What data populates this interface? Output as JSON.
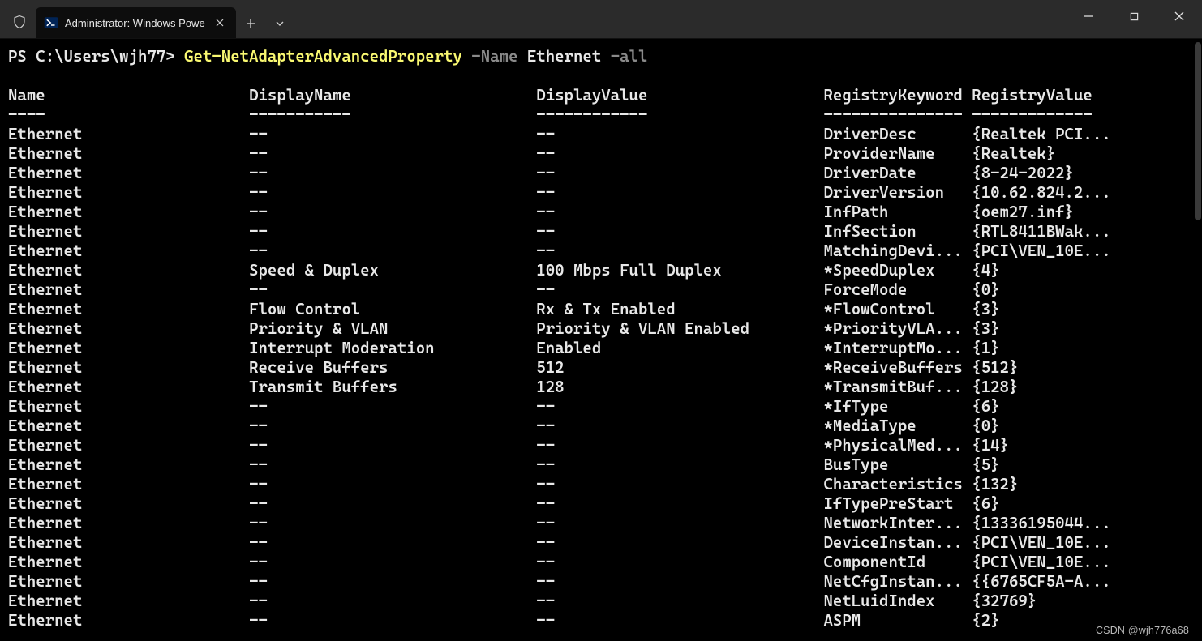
{
  "window": {
    "tab_title": "Administrator: Windows Powe",
    "watermark": "CSDN @wjh776a68"
  },
  "prompt": {
    "prefix": "PS C:\\Users\\wjh77> ",
    "command": "Get-NetAdapterAdvancedProperty",
    "param1": " -Name ",
    "arg1": "Ethernet",
    "param2": " -all"
  },
  "columns": {
    "name": "Name",
    "display_name": "DisplayName",
    "display_value": "DisplayValue",
    "registry_keyword": "RegistryKeyword",
    "registry_value": "RegistryValue"
  },
  "rows": [
    {
      "n": "Ethernet",
      "dn": "--",
      "dv": "--",
      "rk": "DriverDesc",
      "rv": "{Realtek PCI..."
    },
    {
      "n": "Ethernet",
      "dn": "--",
      "dv": "--",
      "rk": "ProviderName",
      "rv": "{Realtek}"
    },
    {
      "n": "Ethernet",
      "dn": "--",
      "dv": "--",
      "rk": "DriverDate",
      "rv": "{8-24-2022}"
    },
    {
      "n": "Ethernet",
      "dn": "--",
      "dv": "--",
      "rk": "DriverVersion",
      "rv": "{10.62.824.2..."
    },
    {
      "n": "Ethernet",
      "dn": "--",
      "dv": "--",
      "rk": "InfPath",
      "rv": "{oem27.inf}"
    },
    {
      "n": "Ethernet",
      "dn": "--",
      "dv": "--",
      "rk": "InfSection",
      "rv": "{RTL8411BWak..."
    },
    {
      "n": "Ethernet",
      "dn": "--",
      "dv": "--",
      "rk": "MatchingDevi...",
      "rv": "{PCI\\VEN_10E..."
    },
    {
      "n": "Ethernet",
      "dn": "Speed & Duplex",
      "dv": "100 Mbps Full Duplex",
      "rk": "*SpeedDuplex",
      "rv": "{4}"
    },
    {
      "n": "Ethernet",
      "dn": "--",
      "dv": "--",
      "rk": "ForceMode",
      "rv": "{0}"
    },
    {
      "n": "Ethernet",
      "dn": "Flow Control",
      "dv": "Rx & Tx Enabled",
      "rk": "*FlowControl",
      "rv": "{3}"
    },
    {
      "n": "Ethernet",
      "dn": "Priority & VLAN",
      "dv": "Priority & VLAN Enabled",
      "rk": "*PriorityVLA...",
      "rv": "{3}"
    },
    {
      "n": "Ethernet",
      "dn": "Interrupt Moderation",
      "dv": "Enabled",
      "rk": "*InterruptMo...",
      "rv": "{1}"
    },
    {
      "n": "Ethernet",
      "dn": "Receive Buffers",
      "dv": "512",
      "rk": "*ReceiveBuffers",
      "rv": "{512}"
    },
    {
      "n": "Ethernet",
      "dn": "Transmit Buffers",
      "dv": "128",
      "rk": "*TransmitBuf...",
      "rv": "{128}"
    },
    {
      "n": "Ethernet",
      "dn": "--",
      "dv": "--",
      "rk": "*IfType",
      "rv": "{6}"
    },
    {
      "n": "Ethernet",
      "dn": "--",
      "dv": "--",
      "rk": "*MediaType",
      "rv": "{0}"
    },
    {
      "n": "Ethernet",
      "dn": "--",
      "dv": "--",
      "rk": "*PhysicalMed...",
      "rv": "{14}"
    },
    {
      "n": "Ethernet",
      "dn": "--",
      "dv": "--",
      "rk": "BusType",
      "rv": "{5}"
    },
    {
      "n": "Ethernet",
      "dn": "--",
      "dv": "--",
      "rk": "Characteristics",
      "rv": "{132}"
    },
    {
      "n": "Ethernet",
      "dn": "--",
      "dv": "--",
      "rk": "IfTypePreStart",
      "rv": "{6}"
    },
    {
      "n": "Ethernet",
      "dn": "--",
      "dv": "--",
      "rk": "NetworkInter...",
      "rv": "{13336195044..."
    },
    {
      "n": "Ethernet",
      "dn": "--",
      "dv": "--",
      "rk": "DeviceInstan...",
      "rv": "{PCI\\VEN_10E..."
    },
    {
      "n": "Ethernet",
      "dn": "--",
      "dv": "--",
      "rk": "ComponentId",
      "rv": "{PCI\\VEN_10E..."
    },
    {
      "n": "Ethernet",
      "dn": "--",
      "dv": "--",
      "rk": "NetCfgInstan...",
      "rv": "{{6765CF5A-A..."
    },
    {
      "n": "Ethernet",
      "dn": "--",
      "dv": "--",
      "rk": "NetLuidIndex",
      "rv": "{32769}"
    },
    {
      "n": "Ethernet",
      "dn": "--",
      "dv": "--",
      "rk": "ASPM",
      "rv": "{2}"
    }
  ],
  "col_widths": {
    "name": 26,
    "display_name": 31,
    "display_value": 31,
    "registry_keyword": 16
  }
}
